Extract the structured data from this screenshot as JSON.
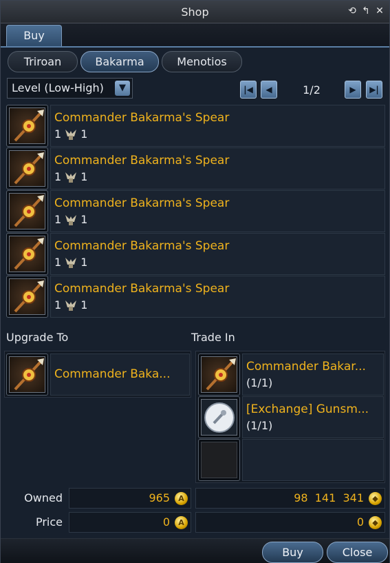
{
  "window": {
    "title": "Shop"
  },
  "tabs": {
    "buy": "Buy"
  },
  "subtabs": [
    "Triroan",
    "Bakarma",
    "Menotios"
  ],
  "sort": {
    "label": "Level (Low-High)"
  },
  "pager": {
    "page": "1/2"
  },
  "items": [
    {
      "name": "Commander Bakarma's Spear",
      "count": "1",
      "cost": "1"
    },
    {
      "name": "Commander Bakarma's Spear",
      "count": "1",
      "cost": "1"
    },
    {
      "name": "Commander Bakarma's Spear",
      "count": "1",
      "cost": "1"
    },
    {
      "name": "Commander Bakarma's Spear",
      "count": "1",
      "cost": "1"
    },
    {
      "name": "Commander Bakarma's Spear",
      "count": "1",
      "cost": "1"
    }
  ],
  "upgrade": {
    "label": "Upgrade To",
    "name": "Commander Baka..."
  },
  "trade": {
    "label": "Trade In",
    "items": [
      {
        "name": "Commander Bakar...",
        "count": "(1/1)"
      },
      {
        "name": "[Exchange] Gunsm...",
        "count": "(1/1)"
      }
    ]
  },
  "owned": {
    "label": "Owned",
    "left": "965",
    "right": "98  141  341"
  },
  "price": {
    "label": "Price",
    "left": "0",
    "right": "0"
  },
  "buttons": {
    "buy": "Buy",
    "close": "Close"
  }
}
